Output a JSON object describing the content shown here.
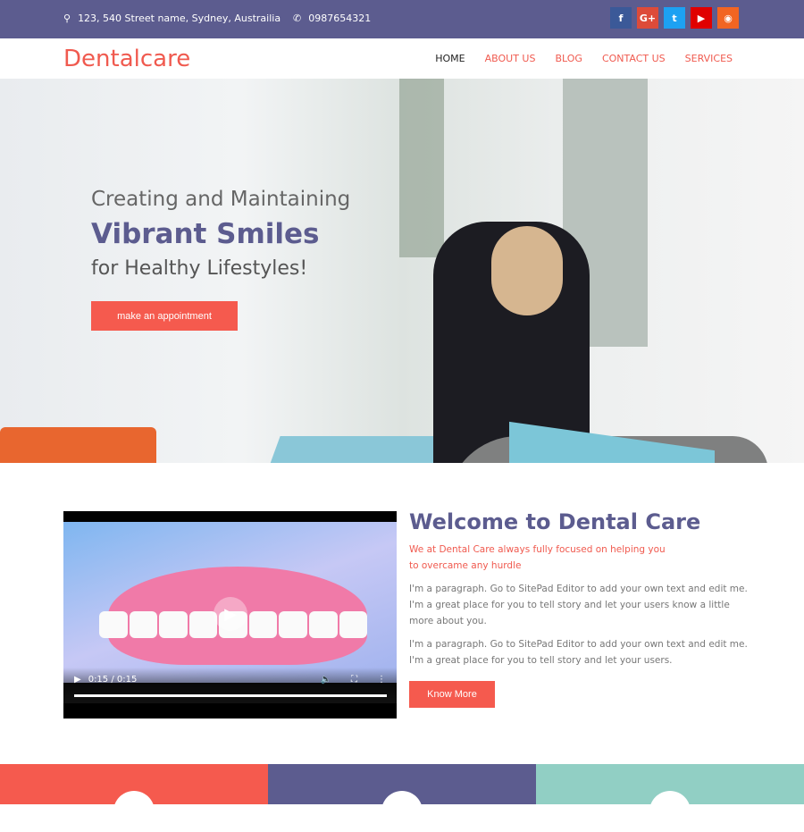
{
  "topbar": {
    "address": "123, 540 Street name, Sydney, Austrailia",
    "phone": "0987654321",
    "social": [
      {
        "icon": "facebook-icon",
        "glyph": "f",
        "color": "#3b5998"
      },
      {
        "icon": "google-plus-icon",
        "glyph": "G+",
        "color": "#dd4b39"
      },
      {
        "icon": "twitter-icon",
        "glyph": "t",
        "color": "#1da1f2"
      },
      {
        "icon": "youtube-icon",
        "glyph": "▶",
        "color": "#e00000"
      },
      {
        "icon": "rss-icon",
        "glyph": "◉",
        "color": "#f26522"
      }
    ]
  },
  "nav": {
    "logo": "Dentalcare",
    "items": [
      "HOME",
      "ABOUT US",
      "BLOG",
      "CONTACT US",
      "SERVICES"
    ]
  },
  "hero": {
    "line1": "Creating and Maintaining",
    "line2": "Vibrant Smiles",
    "line3": "for Healthy Lifestyles!",
    "button": "make an appointment"
  },
  "video": {
    "time": "0:15 / 0:15",
    "progress": 1.0
  },
  "welcome": {
    "title": "Welcome to Dental Care",
    "subtitle1": "We at Dental Care always fully focused on helping you",
    "subtitle2": "to overcame any hurdle",
    "p1": "I'm a paragraph. Go to SitePad Editor to add your own text and edit me. I'm a great place for you to tell story and let your users know a little more about you.",
    "p2": "I'm a paragraph. Go to SitePad Editor to add your own text and edit me. I'm a great place for you to tell story and let your users.",
    "button": "Know More"
  },
  "colors": {
    "accent": "#f55a4e",
    "primary": "#5c5c8f",
    "teal": "#91cfc4"
  }
}
